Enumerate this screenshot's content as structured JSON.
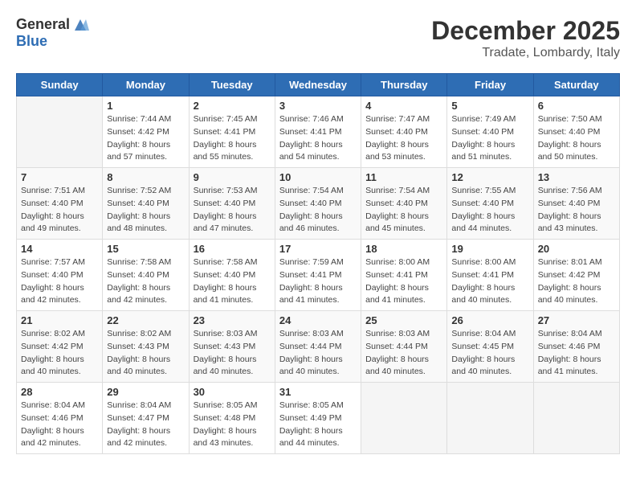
{
  "header": {
    "logo_general": "General",
    "logo_blue": "Blue",
    "title": "December 2025",
    "subtitle": "Tradate, Lombardy, Italy"
  },
  "weekdays": [
    "Sunday",
    "Monday",
    "Tuesday",
    "Wednesday",
    "Thursday",
    "Friday",
    "Saturday"
  ],
  "weeks": [
    [
      {
        "day": "",
        "sunrise": "",
        "sunset": "",
        "daylight": ""
      },
      {
        "day": "1",
        "sunrise": "Sunrise: 7:44 AM",
        "sunset": "Sunset: 4:42 PM",
        "daylight": "Daylight: 8 hours and 57 minutes."
      },
      {
        "day": "2",
        "sunrise": "Sunrise: 7:45 AM",
        "sunset": "Sunset: 4:41 PM",
        "daylight": "Daylight: 8 hours and 55 minutes."
      },
      {
        "day": "3",
        "sunrise": "Sunrise: 7:46 AM",
        "sunset": "Sunset: 4:41 PM",
        "daylight": "Daylight: 8 hours and 54 minutes."
      },
      {
        "day": "4",
        "sunrise": "Sunrise: 7:47 AM",
        "sunset": "Sunset: 4:40 PM",
        "daylight": "Daylight: 8 hours and 53 minutes."
      },
      {
        "day": "5",
        "sunrise": "Sunrise: 7:49 AM",
        "sunset": "Sunset: 4:40 PM",
        "daylight": "Daylight: 8 hours and 51 minutes."
      },
      {
        "day": "6",
        "sunrise": "Sunrise: 7:50 AM",
        "sunset": "Sunset: 4:40 PM",
        "daylight": "Daylight: 8 hours and 50 minutes."
      }
    ],
    [
      {
        "day": "7",
        "sunrise": "Sunrise: 7:51 AM",
        "sunset": "Sunset: 4:40 PM",
        "daylight": "Daylight: 8 hours and 49 minutes."
      },
      {
        "day": "8",
        "sunrise": "Sunrise: 7:52 AM",
        "sunset": "Sunset: 4:40 PM",
        "daylight": "Daylight: 8 hours and 48 minutes."
      },
      {
        "day": "9",
        "sunrise": "Sunrise: 7:53 AM",
        "sunset": "Sunset: 4:40 PM",
        "daylight": "Daylight: 8 hours and 47 minutes."
      },
      {
        "day": "10",
        "sunrise": "Sunrise: 7:54 AM",
        "sunset": "Sunset: 4:40 PM",
        "daylight": "Daylight: 8 hours and 46 minutes."
      },
      {
        "day": "11",
        "sunrise": "Sunrise: 7:54 AM",
        "sunset": "Sunset: 4:40 PM",
        "daylight": "Daylight: 8 hours and 45 minutes."
      },
      {
        "day": "12",
        "sunrise": "Sunrise: 7:55 AM",
        "sunset": "Sunset: 4:40 PM",
        "daylight": "Daylight: 8 hours and 44 minutes."
      },
      {
        "day": "13",
        "sunrise": "Sunrise: 7:56 AM",
        "sunset": "Sunset: 4:40 PM",
        "daylight": "Daylight: 8 hours and 43 minutes."
      }
    ],
    [
      {
        "day": "14",
        "sunrise": "Sunrise: 7:57 AM",
        "sunset": "Sunset: 4:40 PM",
        "daylight": "Daylight: 8 hours and 42 minutes."
      },
      {
        "day": "15",
        "sunrise": "Sunrise: 7:58 AM",
        "sunset": "Sunset: 4:40 PM",
        "daylight": "Daylight: 8 hours and 42 minutes."
      },
      {
        "day": "16",
        "sunrise": "Sunrise: 7:58 AM",
        "sunset": "Sunset: 4:40 PM",
        "daylight": "Daylight: 8 hours and 41 minutes."
      },
      {
        "day": "17",
        "sunrise": "Sunrise: 7:59 AM",
        "sunset": "Sunset: 4:41 PM",
        "daylight": "Daylight: 8 hours and 41 minutes."
      },
      {
        "day": "18",
        "sunrise": "Sunrise: 8:00 AM",
        "sunset": "Sunset: 4:41 PM",
        "daylight": "Daylight: 8 hours and 41 minutes."
      },
      {
        "day": "19",
        "sunrise": "Sunrise: 8:00 AM",
        "sunset": "Sunset: 4:41 PM",
        "daylight": "Daylight: 8 hours and 40 minutes."
      },
      {
        "day": "20",
        "sunrise": "Sunrise: 8:01 AM",
        "sunset": "Sunset: 4:42 PM",
        "daylight": "Daylight: 8 hours and 40 minutes."
      }
    ],
    [
      {
        "day": "21",
        "sunrise": "Sunrise: 8:02 AM",
        "sunset": "Sunset: 4:42 PM",
        "daylight": "Daylight: 8 hours and 40 minutes."
      },
      {
        "day": "22",
        "sunrise": "Sunrise: 8:02 AM",
        "sunset": "Sunset: 4:43 PM",
        "daylight": "Daylight: 8 hours and 40 minutes."
      },
      {
        "day": "23",
        "sunrise": "Sunrise: 8:03 AM",
        "sunset": "Sunset: 4:43 PM",
        "daylight": "Daylight: 8 hours and 40 minutes."
      },
      {
        "day": "24",
        "sunrise": "Sunrise: 8:03 AM",
        "sunset": "Sunset: 4:44 PM",
        "daylight": "Daylight: 8 hours and 40 minutes."
      },
      {
        "day": "25",
        "sunrise": "Sunrise: 8:03 AM",
        "sunset": "Sunset: 4:44 PM",
        "daylight": "Daylight: 8 hours and 40 minutes."
      },
      {
        "day": "26",
        "sunrise": "Sunrise: 8:04 AM",
        "sunset": "Sunset: 4:45 PM",
        "daylight": "Daylight: 8 hours and 40 minutes."
      },
      {
        "day": "27",
        "sunrise": "Sunrise: 8:04 AM",
        "sunset": "Sunset: 4:46 PM",
        "daylight": "Daylight: 8 hours and 41 minutes."
      }
    ],
    [
      {
        "day": "28",
        "sunrise": "Sunrise: 8:04 AM",
        "sunset": "Sunset: 4:46 PM",
        "daylight": "Daylight: 8 hours and 42 minutes."
      },
      {
        "day": "29",
        "sunrise": "Sunrise: 8:04 AM",
        "sunset": "Sunset: 4:47 PM",
        "daylight": "Daylight: 8 hours and 42 minutes."
      },
      {
        "day": "30",
        "sunrise": "Sunrise: 8:05 AM",
        "sunset": "Sunset: 4:48 PM",
        "daylight": "Daylight: 8 hours and 43 minutes."
      },
      {
        "day": "31",
        "sunrise": "Sunrise: 8:05 AM",
        "sunset": "Sunset: 4:49 PM",
        "daylight": "Daylight: 8 hours and 44 minutes."
      },
      {
        "day": "",
        "sunrise": "",
        "sunset": "",
        "daylight": ""
      },
      {
        "day": "",
        "sunrise": "",
        "sunset": "",
        "daylight": ""
      },
      {
        "day": "",
        "sunrise": "",
        "sunset": "",
        "daylight": ""
      }
    ]
  ]
}
